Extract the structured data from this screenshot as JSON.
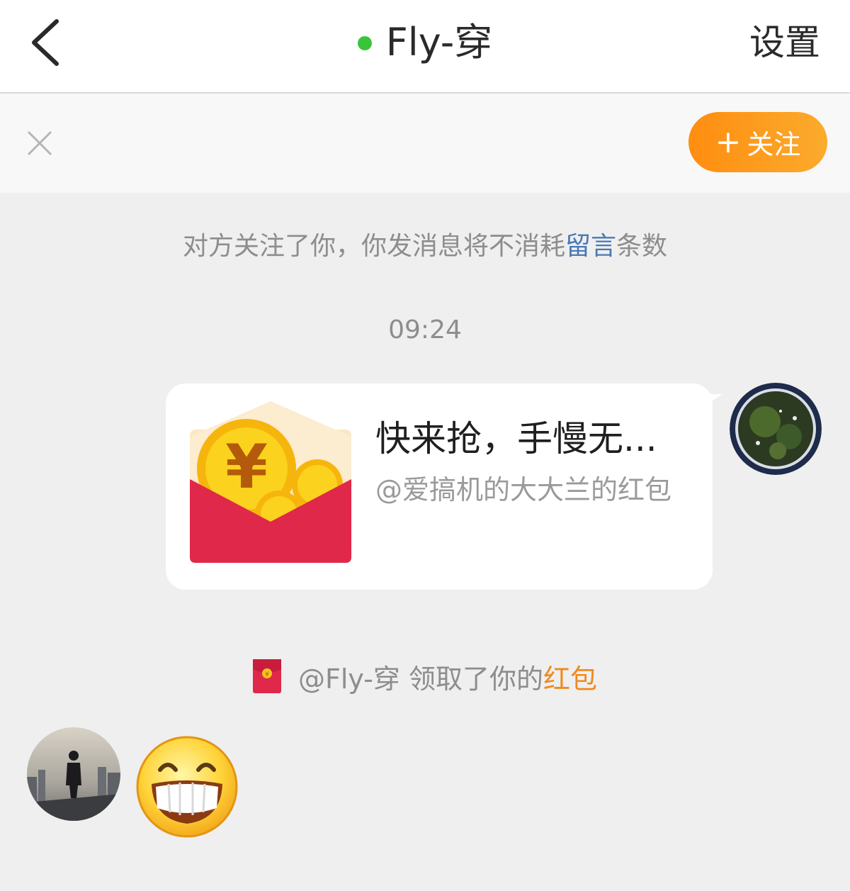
{
  "header": {
    "title": "Fly-穿",
    "settings_label": "设置",
    "online_color": "#3ac43a"
  },
  "follow_bar": {
    "follow_label": "关注",
    "plus_symbol": "+"
  },
  "notice": {
    "prefix": "对方关注了你，你发消息将不消耗",
    "highlight": "留言",
    "suffix": "条数"
  },
  "timestamp": "09:24",
  "red_packet_message": {
    "title": "快来抢，手慢无...",
    "subtitle": "@爱搞机的大大兰的红包"
  },
  "system_message": {
    "text": "@Fly-穿 领取了你的",
    "link": "红包"
  },
  "colors": {
    "accent_orange": "#fb9a20",
    "link_blue": "#4a78b5",
    "red_packet_red": "#e0284a"
  }
}
